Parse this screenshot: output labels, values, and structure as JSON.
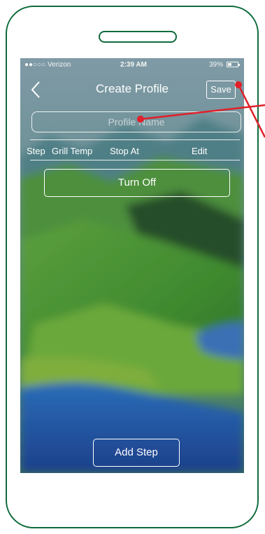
{
  "status_bar": {
    "carrier": "●●○○○ Verizon",
    "time": "2:39 AM",
    "battery": "39%"
  },
  "header": {
    "title": "Create Profile",
    "save_label": "Save"
  },
  "profile_name": {
    "placeholder": "Profile Name",
    "value": ""
  },
  "table": {
    "columns": [
      "Step",
      "Grill Temp",
      "Stop At",
      "Edit"
    ]
  },
  "turn_off_label": "Turn Off",
  "add_step_label": "Add Step",
  "colors": {
    "phone_outline": "#0f6b3c",
    "annotation": "#e0202a"
  }
}
